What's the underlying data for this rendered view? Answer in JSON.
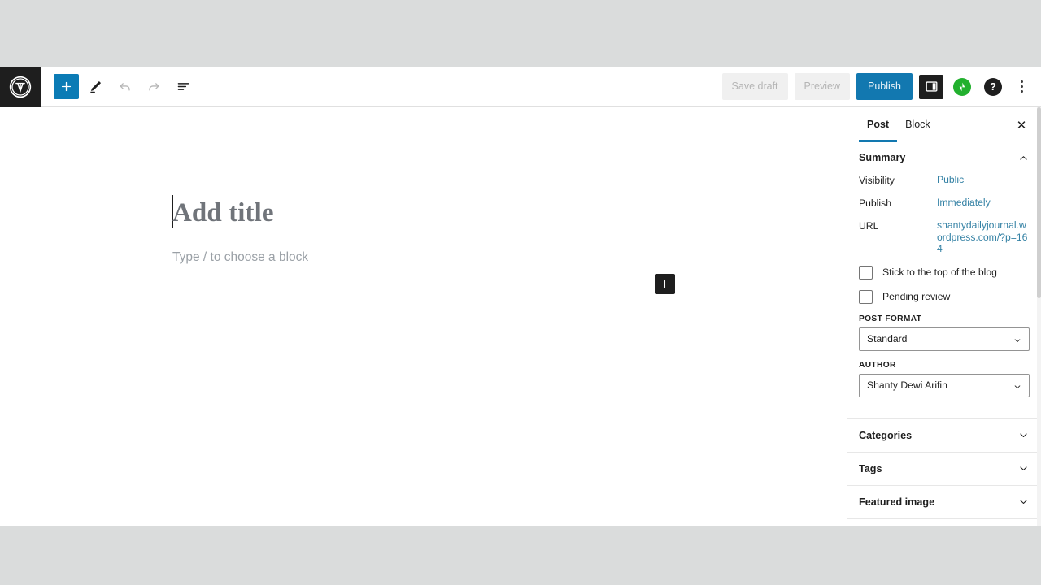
{
  "header": {
    "logo_icon": "wordpress-logo-icon",
    "left_tools": [
      {
        "name": "add-block-button",
        "icon": "plus-icon",
        "label": "",
        "state": "primary"
      },
      {
        "name": "tools-pencil-button",
        "icon": "pencil-icon",
        "label": "",
        "state": "default"
      },
      {
        "name": "undo-button",
        "icon": "undo-arrow-icon",
        "label": "",
        "state": "disabled"
      },
      {
        "name": "redo-button",
        "icon": "redo-arrow-icon",
        "label": "",
        "state": "disabled"
      },
      {
        "name": "list-view-button",
        "icon": "list-view-icon",
        "label": "",
        "state": "default"
      }
    ],
    "save_draft_label": "Save draft",
    "preview_label": "Preview",
    "publish_label": "Publish",
    "settings_toggle_icon": "sidebar-panel-icon",
    "jetpack_icon": "jetpack-icon",
    "help_icon": "help-question-icon",
    "help_glyph": "?",
    "more_options_icon": "kebab-menu-icon"
  },
  "editor": {
    "title_placeholder": "Add title",
    "block_placeholder": "Type / to choose a block",
    "inserter_icon": "plus-icon"
  },
  "sidebar": {
    "tabs": [
      {
        "label": "Post",
        "active": true
      },
      {
        "label": "Block",
        "active": false
      }
    ],
    "close_label": "✕",
    "summary": {
      "title": "Summary",
      "rows": [
        {
          "label": "Visibility",
          "value": "Public"
        },
        {
          "label": "Publish",
          "value": "Immediately"
        },
        {
          "label": "URL",
          "value": "shantydailyjournal.wordpress.com/?p=164"
        }
      ],
      "checkboxes": [
        {
          "label": "Stick to the top of the blog",
          "checked": false
        },
        {
          "label": "Pending review",
          "checked": false
        }
      ],
      "post_format_label": "Post format",
      "post_format_value": "Standard",
      "author_label": "Author",
      "author_value": "Shanty Dewi Arifin"
    },
    "panels": [
      {
        "title": "Categories",
        "expanded": false
      },
      {
        "title": "Tags",
        "expanded": false
      },
      {
        "title": "Featured image",
        "expanded": false
      }
    ]
  },
  "colors": {
    "accent_blue": "#1278b0",
    "link_blue": "#3582a5",
    "chrome_gray": "#dadcdc",
    "dark": "#1e1e1e",
    "jetpack_green": "#22b02e"
  }
}
